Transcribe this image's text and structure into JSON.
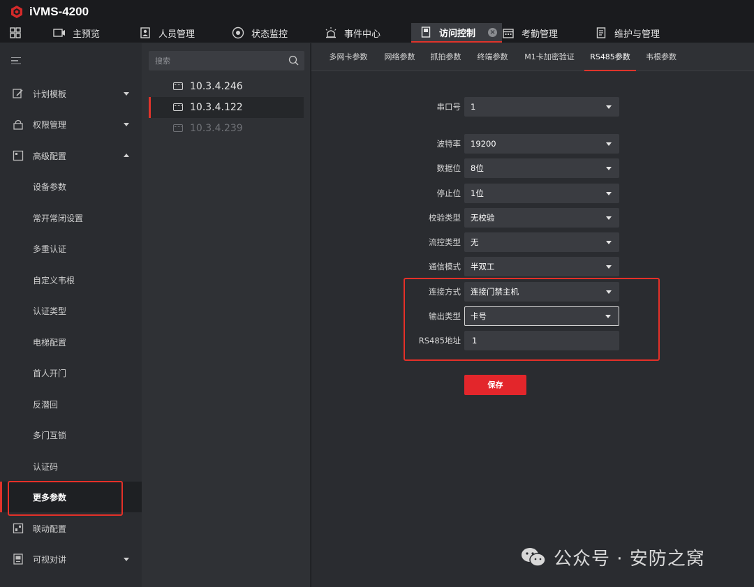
{
  "app": {
    "title": "iVMS-4200"
  },
  "colors": {
    "accent": "#e0342b",
    "highlight": "#e53028",
    "save_button": "#e3262b"
  },
  "tabs": [
    {
      "label": "主预览",
      "icon": "monitor-icon"
    },
    {
      "label": "人员管理",
      "icon": "person-icon"
    },
    {
      "label": "状态监控",
      "icon": "dial-icon"
    },
    {
      "label": "事件中心",
      "icon": "alarm-icon"
    },
    {
      "label": "访问控制",
      "icon": "door-icon",
      "active": true
    },
    {
      "label": "考勤管理",
      "icon": "calendar-icon"
    },
    {
      "label": "维护与管理",
      "icon": "clipboard-icon"
    }
  ],
  "sidebar": {
    "items": [
      {
        "label": "计划模板",
        "icon": "edit-icon"
      },
      {
        "label": "权限管理",
        "icon": "lock-icon"
      },
      {
        "label": "高级配置",
        "icon": "grid-icon"
      },
      {
        "label": "设备参数"
      },
      {
        "label": "常开常闭设置"
      },
      {
        "label": "多重认证"
      },
      {
        "label": "自定义韦根"
      },
      {
        "label": "认证类型"
      },
      {
        "label": "电梯配置"
      },
      {
        "label": "首人开门"
      },
      {
        "label": "反潜回"
      },
      {
        "label": "多门互锁"
      },
      {
        "label": "认证码"
      },
      {
        "label": "更多参数",
        "active": true
      },
      {
        "label": "联动配置",
        "icon": "link-icon"
      },
      {
        "label": "可视对讲",
        "icon": "intercom-icon"
      }
    ]
  },
  "devices": {
    "search_placeholder": "搜索",
    "items": [
      {
        "label": "10.3.4.246"
      },
      {
        "label": "10.3.4.122",
        "active": true
      },
      {
        "label": "10.3.4.239",
        "offline": true
      }
    ]
  },
  "subtabs": [
    {
      "label": "多网卡参数"
    },
    {
      "label": "网络参数"
    },
    {
      "label": "抓拍参数"
    },
    {
      "label": "终端参数"
    },
    {
      "label": "M1卡加密验证"
    },
    {
      "label": "RS485参数",
      "active": true
    },
    {
      "label": "韦根参数"
    }
  ],
  "form": {
    "serial_port": {
      "label": "串口号",
      "value": "1"
    },
    "baud_rate": {
      "label": "波特率",
      "value": "19200"
    },
    "data_bits": {
      "label": "数据位",
      "value": "8位"
    },
    "stop_bits": {
      "label": "停止位",
      "value": "1位"
    },
    "parity": {
      "label": "校验类型",
      "value": "无校验"
    },
    "flow_control": {
      "label": "流控类型",
      "value": "无"
    },
    "comm_mode": {
      "label": "通信模式",
      "value": "半双工"
    },
    "connect_mode": {
      "label": "连接方式",
      "value": "连接门禁主机"
    },
    "output_type": {
      "label": "输出类型",
      "value": "卡号"
    },
    "rs485_address": {
      "label": "RS485地址",
      "value": "1"
    },
    "save_label": "保存"
  },
  "watermark": {
    "text": "公众号 · 安防之窝"
  }
}
